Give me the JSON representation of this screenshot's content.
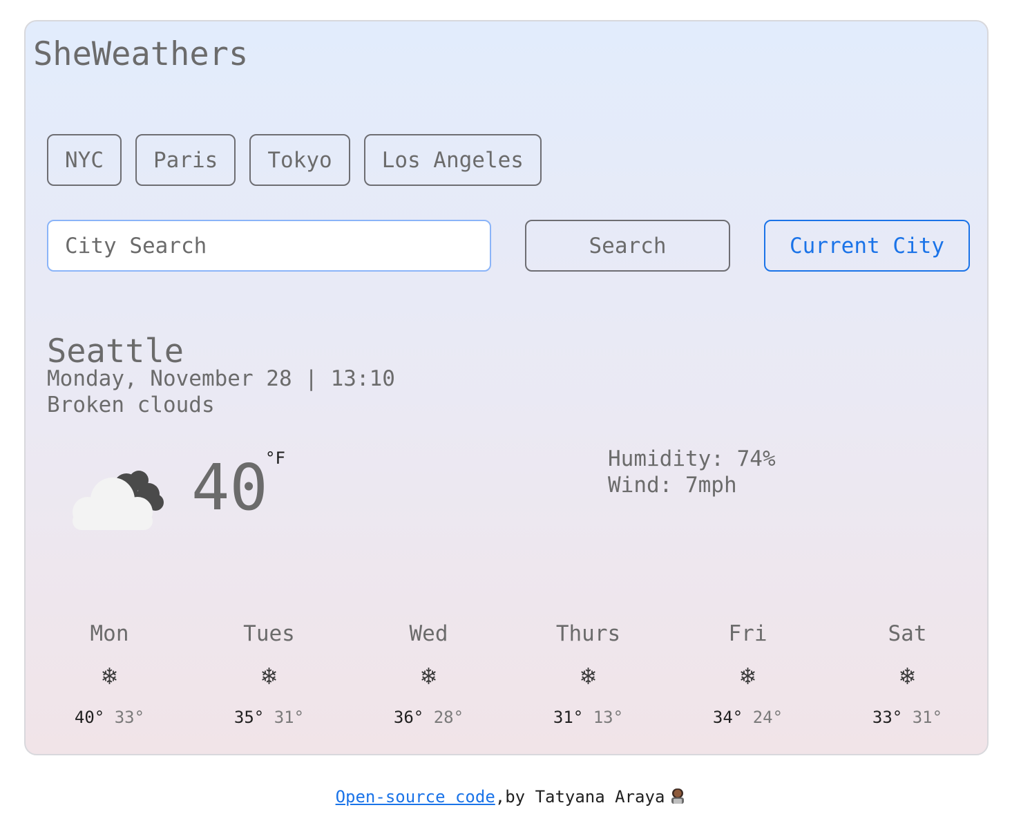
{
  "app": {
    "title": "SheWeathers"
  },
  "quick_cities": [
    "NYC",
    "Paris",
    "Tokyo",
    "Los Angeles"
  ],
  "search": {
    "placeholder": "City Search",
    "button_label": "Search",
    "current_city_label": "Current City"
  },
  "current": {
    "city": "Seattle",
    "datetime": "Monday, November 28 | 13:10",
    "description": "Broken clouds",
    "icon": "broken-clouds-icon",
    "temperature": "40",
    "unit": "°F",
    "humidity": "Humidity: 74%",
    "wind": "Wind: 7mph"
  },
  "forecast": [
    {
      "day": "Mon",
      "icon": "snowflake-icon",
      "max": "40°",
      "min": "33°"
    },
    {
      "day": "Tues",
      "icon": "snowflake-icon",
      "max": "35°",
      "min": "31°"
    },
    {
      "day": "Wed",
      "icon": "snowflake-icon",
      "max": "36°",
      "min": "28°"
    },
    {
      "day": "Thurs",
      "icon": "snowflake-icon",
      "max": "31°",
      "min": "13°"
    },
    {
      "day": "Fri",
      "icon": "snowflake-icon",
      "max": "34°",
      "min": "24°"
    },
    {
      "day": "Sat",
      "icon": "snowflake-icon",
      "max": "33°",
      "min": "31°"
    }
  ],
  "footer": {
    "link_text": "Open-source code",
    "suffix": ",by Tatyana Araya",
    "icon": "woman-technologist-icon"
  },
  "colors": {
    "accent": "#1a73e8",
    "text": "#6b6b6b",
    "input_border": "#8ab4f8"
  }
}
